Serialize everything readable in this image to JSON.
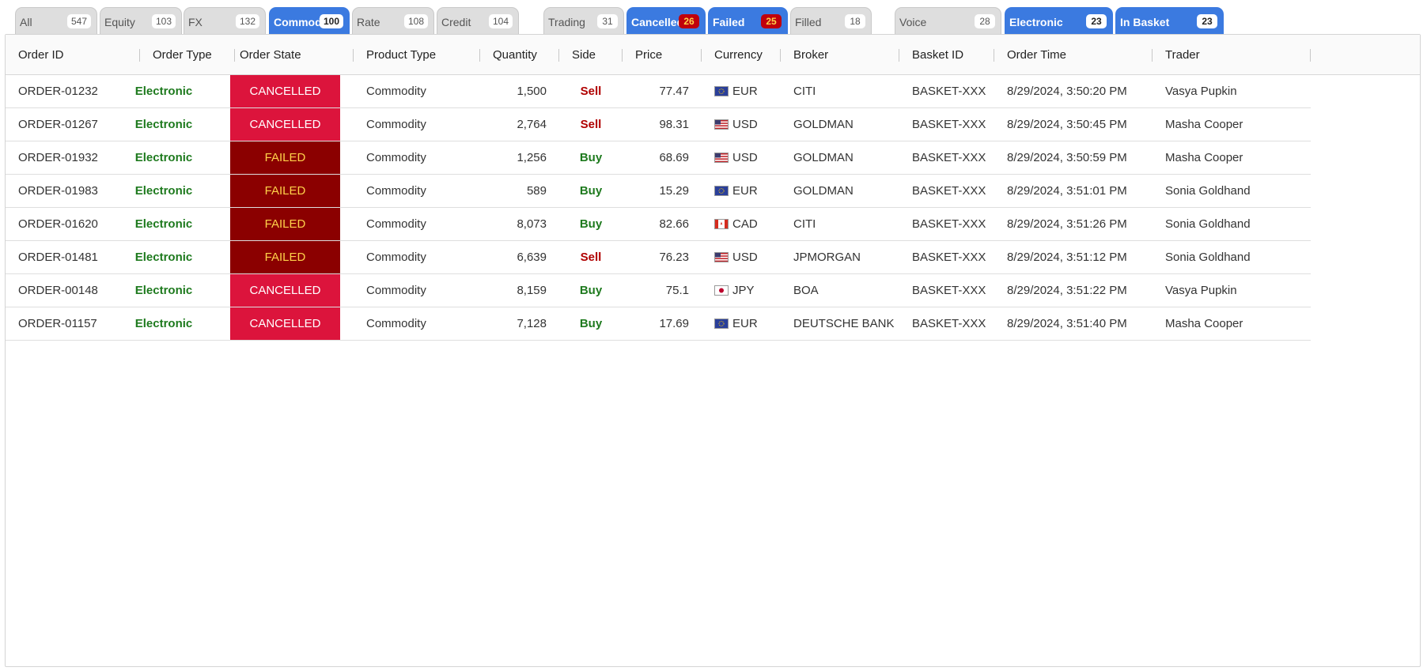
{
  "tabs": [
    {
      "label": "All",
      "count": "547",
      "active": false,
      "alert": false
    },
    {
      "label": "Equity",
      "count": "103",
      "active": false,
      "alert": false
    },
    {
      "label": "FX",
      "count": "132",
      "active": false,
      "alert": false
    },
    {
      "label": "Commodity",
      "count": "100",
      "active": true,
      "alert": false
    },
    {
      "label": "Rate",
      "count": "108",
      "active": false,
      "alert": false
    },
    {
      "label": "Credit",
      "count": "104",
      "active": false,
      "alert": false
    },
    {
      "label": "Trading",
      "count": "31",
      "active": false,
      "alert": false
    },
    {
      "label": "Cancelled",
      "count": "26",
      "active": true,
      "alert": true
    },
    {
      "label": "Failed",
      "count": "25",
      "active": true,
      "alert": true
    },
    {
      "label": "Filled",
      "count": "18",
      "active": false,
      "alert": false
    },
    {
      "label": "Voice",
      "count": "28",
      "active": false,
      "alert": false
    },
    {
      "label": "Electronic",
      "count": "23",
      "active": true,
      "alert": false
    },
    {
      "label": "In Basket",
      "count": "23",
      "active": true,
      "alert": false
    }
  ],
  "columns": [
    "Order ID",
    "Order Type",
    "Order State",
    "Product Type",
    "Quantity",
    "Side",
    "Price",
    "Currency",
    "Broker",
    "Basket ID",
    "Order Time",
    "Trader"
  ],
  "rows": [
    {
      "order_id": "ORDER-01232",
      "order_type": "Electronic",
      "order_state": "CANCELLED",
      "product_type": "Commodity",
      "quantity": "1,500",
      "side": "Sell",
      "price": "77.47",
      "currency": "EUR",
      "flag": "eu-flag-icon",
      "broker": "CITI",
      "basket_id": "BASKET-XXX",
      "order_time": "8/29/2024, 3:50:20 PM",
      "trader": "Vasya Pupkin"
    },
    {
      "order_id": "ORDER-01267",
      "order_type": "Electronic",
      "order_state": "CANCELLED",
      "product_type": "Commodity",
      "quantity": "2,764",
      "side": "Sell",
      "price": "98.31",
      "currency": "USD",
      "flag": "us-flag-icon",
      "broker": "GOLDMAN",
      "basket_id": "BASKET-XXX",
      "order_time": "8/29/2024, 3:50:45 PM",
      "trader": "Masha Cooper"
    },
    {
      "order_id": "ORDER-01932",
      "order_type": "Electronic",
      "order_state": "FAILED",
      "product_type": "Commodity",
      "quantity": "1,256",
      "side": "Buy",
      "price": "68.69",
      "currency": "USD",
      "flag": "us-flag-icon",
      "broker": "GOLDMAN",
      "basket_id": "BASKET-XXX",
      "order_time": "8/29/2024, 3:50:59 PM",
      "trader": "Masha Cooper"
    },
    {
      "order_id": "ORDER-01983",
      "order_type": "Electronic",
      "order_state": "FAILED",
      "product_type": "Commodity",
      "quantity": "589",
      "side": "Buy",
      "price": "15.29",
      "currency": "EUR",
      "flag": "eu-flag-icon",
      "broker": "GOLDMAN",
      "basket_id": "BASKET-XXX",
      "order_time": "8/29/2024, 3:51:01 PM",
      "trader": "Sonia Goldhand"
    },
    {
      "order_id": "ORDER-01620",
      "order_type": "Electronic",
      "order_state": "FAILED",
      "product_type": "Commodity",
      "quantity": "8,073",
      "side": "Buy",
      "price": "82.66",
      "currency": "CAD",
      "flag": "ca-flag-icon",
      "broker": "CITI",
      "basket_id": "BASKET-XXX",
      "order_time": "8/29/2024, 3:51:26 PM",
      "trader": "Sonia Goldhand"
    },
    {
      "order_id": "ORDER-01481",
      "order_type": "Electronic",
      "order_state": "FAILED",
      "product_type": "Commodity",
      "quantity": "6,639",
      "side": "Sell",
      "price": "76.23",
      "currency": "USD",
      "flag": "us-flag-icon",
      "broker": "JPMORGAN",
      "basket_id": "BASKET-XXX",
      "order_time": "8/29/2024, 3:51:12 PM",
      "trader": "Sonia Goldhand"
    },
    {
      "order_id": "ORDER-00148",
      "order_type": "Electronic",
      "order_state": "CANCELLED",
      "product_type": "Commodity",
      "quantity": "8,159",
      "side": "Buy",
      "price": "75.1",
      "currency": "JPY",
      "flag": "jp-flag-icon",
      "broker": "BOA",
      "basket_id": "BASKET-XXX",
      "order_time": "8/29/2024, 3:51:22 PM",
      "trader": "Vasya Pupkin"
    },
    {
      "order_id": "ORDER-01157",
      "order_type": "Electronic",
      "order_state": "CANCELLED",
      "product_type": "Commodity",
      "quantity": "7,128",
      "side": "Buy",
      "price": "17.69",
      "currency": "EUR",
      "flag": "eu-flag-icon",
      "broker": "DEUTSCHE BANK",
      "basket_id": "BASKET-XXX",
      "order_time": "8/29/2024, 3:51:40 PM",
      "trader": "Masha Cooper"
    }
  ],
  "colors": {
    "accent": "#3b7ae0",
    "cancelled": "#dc143c",
    "failed": "#8b0000",
    "failed_text": "#ffd24a",
    "buy": "#1e7a1e",
    "sell": "#b00000"
  }
}
